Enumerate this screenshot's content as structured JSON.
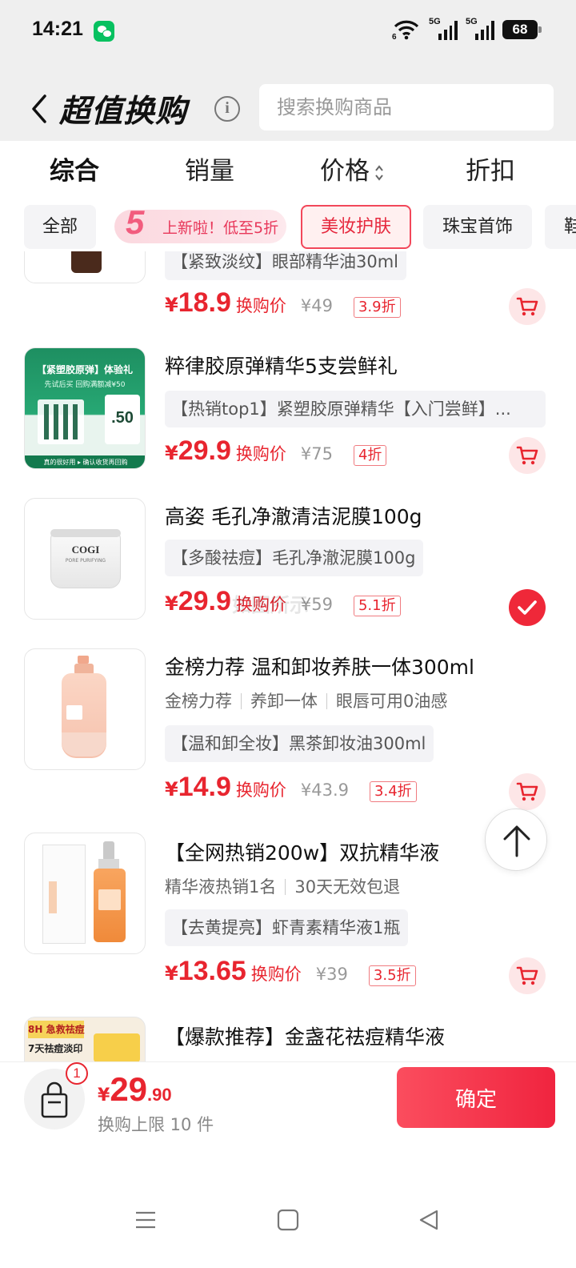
{
  "status_bar": {
    "time": "14:21",
    "signal_1_label": "5G",
    "signal_2_label": "5G",
    "battery": "68",
    "icons": [
      "wechat-icon",
      "wifi-icon",
      "signal-icon",
      "battery-icon"
    ]
  },
  "header": {
    "title": "超值换购",
    "search_placeholder": "搜索换购商品"
  },
  "sort_tabs": [
    {
      "label": "综合",
      "active": true
    },
    {
      "label": "销量",
      "active": false
    },
    {
      "label": "价格",
      "active": false
    },
    {
      "label": "折扣",
      "active": false
    }
  ],
  "chips": {
    "all": "全部",
    "promo_number": "5",
    "promo_text": "上新啦！低至5折",
    "beauty": "美妆护肤",
    "jewelry": "珠宝首饰",
    "partial": "鞋"
  },
  "products": [
    {
      "desc": "【紧致淡纹】眼部精华油30ml",
      "price": "18.9",
      "price_label": "换购价",
      "original": "¥49",
      "discount": "3.9折",
      "selected": false
    },
    {
      "title": "粹律胶原弹精华5支尝鲜礼",
      "desc": "【热销top1】紧塑胶原弹精华【入门尝鲜】...",
      "price": "29.9",
      "price_label": "换购价",
      "original": "¥75",
      "discount": "4折",
      "selected": false,
      "thumb_text": "【紧塑胶原弹】体验礼",
      "thumb_sub": "先试后买 回购满额减¥50",
      "thumb_badge": ".50",
      "thumb_footer": "真的很好用 ▸ 确认收货再回购"
    },
    {
      "title": "高姿 毛孔净澈清洁泥膜100g",
      "desc": "【多酸祛痘】毛孔净澈泥膜100g",
      "price": "29.9",
      "price_label": "换购价",
      "original": "¥59",
      "discount": "5.1折",
      "selected": true,
      "thumb_brand": "COGI",
      "thumb_sub": "PORE PURIFYING"
    },
    {
      "title": "金榜力荐 温和卸妆养肤一体300ml",
      "tags": [
        "金榜力荐",
        "养卸一体",
        "眼唇可用0油感"
      ],
      "desc": "【温和卸全妆】黑茶卸妆油300ml",
      "price": "14.9",
      "price_label": "换购价",
      "original": "¥43.9",
      "discount": "3.4折",
      "selected": false
    },
    {
      "title": "【全网热销200w】双抗精华液",
      "tags": [
        "精华液热销1名",
        "30天无效包退"
      ],
      "desc": "【去黄提亮】虾青素精华液1瓶",
      "price": "13.65",
      "price_label": "换购价",
      "original": "¥39",
      "discount": "3.5折",
      "selected": false
    },
    {
      "title": "【爆款推荐】金盏花祛痘精华液",
      "thumb_text_1": "8H 急救祛痘",
      "thumb_text_2": "7天祛痘淡印"
    }
  ],
  "watermark": "如图所示",
  "bottom": {
    "badge_count": "1",
    "currency": "¥",
    "total_int": "29",
    "total_dec": ".90",
    "limit_text": "换购上限 10 件",
    "confirm": "确定"
  },
  "colors": {
    "accent": "#e8252f",
    "selected_chip": "#f2475a",
    "check": "#ef2839"
  }
}
